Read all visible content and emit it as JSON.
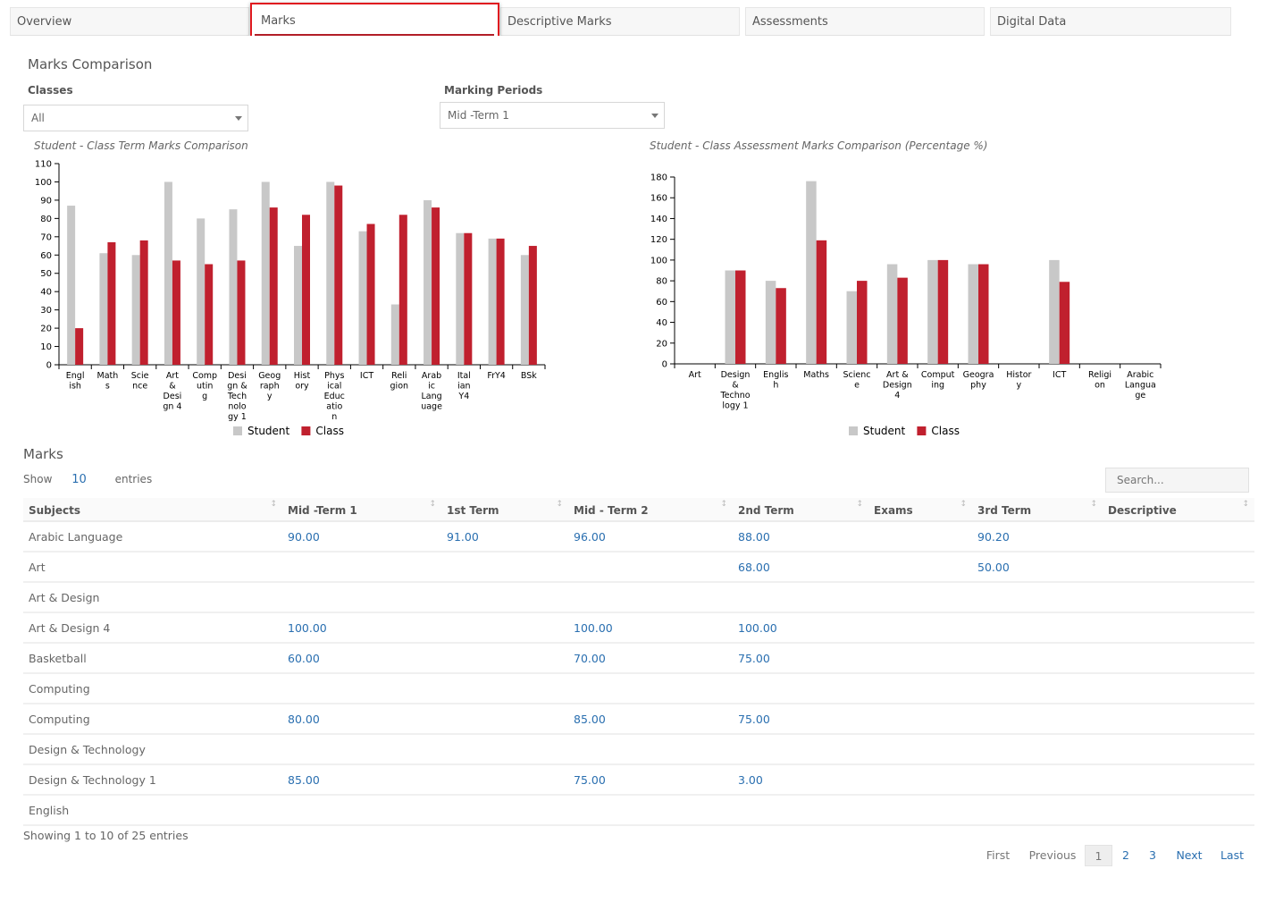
{
  "tabs": [
    "Overview",
    "Marks",
    "Descriptive Marks",
    "Assessments",
    "Digital Data"
  ],
  "active_tab": "Marks",
  "comparison": {
    "title": "Marks Comparison",
    "classes_label": "Classes",
    "classes_value": "All",
    "periods_label": "Marking Periods",
    "periods_value": "Mid -Term 1"
  },
  "chart_data": [
    {
      "type": "bar",
      "title": "Student - Class Term Marks Comparison",
      "categories": [
        "English",
        "Maths",
        "Science",
        "Art & Design 4",
        "Computing",
        "Design & Technology 1",
        "Geography",
        "History",
        "Physical Education",
        "ICT",
        "Religion",
        "Arabic Language",
        "Italian Y4",
        "FrY4",
        "BSk"
      ],
      "category_lines": [
        [
          "Engl",
          "ish"
        ],
        [
          "Math",
          "s"
        ],
        [
          "Scie",
          "nce"
        ],
        [
          "Art",
          "&",
          "Desi",
          "gn 4"
        ],
        [
          "Comp",
          "utin",
          "g"
        ],
        [
          "Desi",
          "gn &",
          "Tech",
          "nolo",
          "gy 1"
        ],
        [
          "Geog",
          "raph",
          "y"
        ],
        [
          "Hist",
          "ory"
        ],
        [
          "Phys",
          "ical",
          "Educ",
          "atio",
          "n"
        ],
        [
          "ICT"
        ],
        [
          "Reli",
          "gion"
        ],
        [
          "Arab",
          "ic",
          "Lang",
          "uage"
        ],
        [
          "Ital",
          "ian",
          "Y4"
        ],
        [
          "FrY4"
        ],
        [
          "BSk"
        ]
      ],
      "series": [
        {
          "name": "Student",
          "color": "#c8c8c8",
          "values": [
            87,
            61,
            60,
            100,
            80,
            85,
            100,
            65,
            100,
            73,
            33,
            90,
            72,
            69,
            60
          ]
        },
        {
          "name": "Class",
          "color": "#c0202e",
          "values": [
            20,
            67,
            68,
            57,
            55,
            57,
            86,
            82,
            98,
            77,
            82,
            86,
            72,
            69,
            65
          ]
        }
      ],
      "yticks": [
        0,
        10,
        20,
        30,
        40,
        50,
        60,
        70,
        80,
        90,
        100,
        110
      ],
      "ylim": [
        0,
        110
      ],
      "legend": "bottom-center"
    },
    {
      "type": "bar",
      "title": "Student - Class Assessment Marks Comparison (Percentage %)",
      "categories": [
        "Art",
        "Design & Technology 1",
        "English",
        "Maths",
        "Science",
        "Art & Design 4",
        "Computing",
        "Geography",
        "History",
        "ICT",
        "Religion",
        "Arabic Language"
      ],
      "category_lines": [
        [
          "Art"
        ],
        [
          "Design",
          "&",
          "Techno",
          "logy 1"
        ],
        [
          "Englis",
          "h"
        ],
        [
          "Maths"
        ],
        [
          "Scienc",
          "e"
        ],
        [
          "Art &",
          "Design",
          "4"
        ],
        [
          "Comput",
          "ing"
        ],
        [
          "Geogra",
          "phy"
        ],
        [
          "Histor",
          "y"
        ],
        [
          "ICT"
        ],
        [
          "Religi",
          "on"
        ],
        [
          "Arabic",
          "Langua",
          "ge"
        ]
      ],
      "series": [
        {
          "name": "Student",
          "color": "#c8c8c8",
          "values": [
            0,
            90,
            80,
            176,
            70,
            96,
            100,
            96,
            0,
            100,
            0,
            0
          ]
        },
        {
          "name": "Class",
          "color": "#c0202e",
          "values": [
            0,
            90,
            73,
            119,
            80,
            83,
            100,
            96,
            0,
            79,
            0,
            0
          ]
        }
      ],
      "yticks": [
        0,
        20,
        40,
        60,
        80,
        100,
        120,
        140,
        160,
        180
      ],
      "ylim": [
        0,
        180
      ],
      "legend": "bottom-center"
    }
  ],
  "marks": {
    "title": "Marks",
    "show_label": "Show",
    "entries_count": "10",
    "entries_label": "entries",
    "search_placeholder": "Search...",
    "columns": [
      "Subjects",
      "Mid -Term 1",
      "1st Term",
      "Mid - Term 2",
      "2nd Term",
      "Exams",
      "3rd Term",
      "Descriptive"
    ],
    "rows": [
      [
        "Arabic Language",
        "90.00",
        "91.00",
        "96.00",
        "88.00",
        "",
        "90.20",
        ""
      ],
      [
        "Art",
        "",
        "",
        "",
        "68.00",
        "",
        "50.00",
        ""
      ],
      [
        "Art & Design",
        "",
        "",
        "",
        "",
        "",
        "",
        ""
      ],
      [
        "Art & Design 4",
        "100.00",
        "",
        "100.00",
        "100.00",
        "",
        "",
        ""
      ],
      [
        "Basketball",
        "60.00",
        "",
        "70.00",
        "75.00",
        "",
        "",
        ""
      ],
      [
        "Computing",
        "",
        "",
        "",
        "",
        "",
        "",
        ""
      ],
      [
        "Computing",
        "80.00",
        "",
        "85.00",
        "75.00",
        "",
        "",
        ""
      ],
      [
        "Design & Technology",
        "",
        "",
        "",
        "",
        "",
        "",
        ""
      ],
      [
        "Design & Technology 1",
        "85.00",
        "",
        "75.00",
        "3.00",
        "",
        "",
        ""
      ],
      [
        "English",
        "",
        "",
        "",
        "",
        "",
        "",
        ""
      ]
    ],
    "showing_text": "Showing 1 to 10 of 25 entries",
    "pager": {
      "first": "First",
      "previous": "Previous",
      "pages": [
        "1",
        "2",
        "3"
      ],
      "current": "1",
      "next": "Next",
      "last": "Last"
    }
  },
  "colors": {
    "accent": "#b21e28",
    "link": "#2a6fb0",
    "student": "#c8c8c8",
    "class": "#c0202e"
  }
}
